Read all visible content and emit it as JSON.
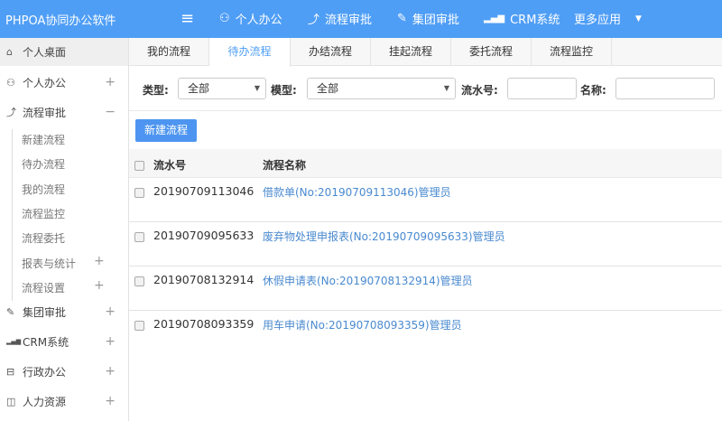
{
  "header": {
    "logo": "PHPOA协同办公软件",
    "nav": [
      {
        "label": "个人办公",
        "icon": "user-icon"
      },
      {
        "label": "流程审批",
        "icon": "flow-icon"
      },
      {
        "label": "集团审批",
        "icon": "edit-icon"
      },
      {
        "label": "CRM系统",
        "icon": "bar-chart-icon"
      },
      {
        "label": "更多应用",
        "icon": "caret-down-icon"
      }
    ]
  },
  "sidebar": {
    "items": [
      {
        "label": "个人桌面",
        "icon": "home-icon",
        "active": true
      },
      {
        "label": "个人办公",
        "icon": "user-icon",
        "toggle": "+"
      },
      {
        "label": "流程审批",
        "icon": "flow-icon",
        "toggle": "−"
      },
      {
        "label": "集团审批",
        "icon": "edit-icon",
        "toggle": "+"
      },
      {
        "label": "CRM系统",
        "icon": "bar-chart-icon",
        "toggle": "+"
      },
      {
        "label": "行政办公",
        "icon": "briefcase-icon",
        "toggle": "+"
      },
      {
        "label": "人力资源",
        "icon": "book-icon",
        "toggle": "+"
      }
    ],
    "subitems": [
      {
        "label": "新建流程"
      },
      {
        "label": "待办流程"
      },
      {
        "label": "我的流程"
      },
      {
        "label": "流程监控"
      },
      {
        "label": "流程委托"
      },
      {
        "label": "报表与统计",
        "toggle": "+"
      },
      {
        "label": "流程设置",
        "toggle": "+"
      }
    ]
  },
  "tabs": [
    {
      "label": "我的流程"
    },
    {
      "label": "待办流程",
      "active": true
    },
    {
      "label": "办结流程"
    },
    {
      "label": "挂起流程"
    },
    {
      "label": "委托流程"
    },
    {
      "label": "流程监控"
    }
  ],
  "filters": {
    "type_label": "类型:",
    "type_value": "全部",
    "model_label": "模型:",
    "model_value": "全部",
    "serial_label": "流水号:",
    "serial_value": "",
    "name_label": "名称:",
    "name_value": ""
  },
  "new_button": "新建流程",
  "table": {
    "columns": [
      "流水号",
      "流程名称"
    ],
    "rows": [
      {
        "serial": "20190709113046",
        "name": "借款单(No:20190709113046)管理员"
      },
      {
        "serial": "20190709095633",
        "name": "废弃物处理申报表(No:20190709095633)管理员"
      },
      {
        "serial": "20190708132914",
        "name": "休假申请表(No:20190708132914)管理员"
      },
      {
        "serial": "20190708093359",
        "name": "用车申请(No:20190708093359)管理员"
      }
    ]
  },
  "colors": {
    "header": "#4f9ef6",
    "link": "#4a8ad0",
    "button": "#4d95f0"
  }
}
